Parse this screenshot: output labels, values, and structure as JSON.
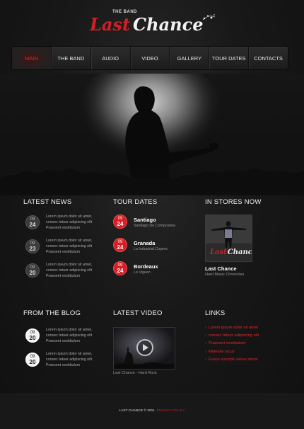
{
  "logo": {
    "small": "THE BAND",
    "word1": "Last",
    "word2": "Chance"
  },
  "nav": [
    "MAIN",
    "THE BAND",
    "AUDIO",
    "VIDEO",
    "GALLERY",
    "TOUR DATES",
    "CONTACTS"
  ],
  "nav_active_index": 0,
  "latest_news": {
    "title": "LATEST NEWS",
    "items": [
      {
        "month": "09",
        "day": "24",
        "l1": "Lorem ipsum dolor sit amet,",
        "l2": "consec tetuer adipiscing elit",
        "l3": "Praesent vestibulum"
      },
      {
        "month": "09",
        "day": "23",
        "l1": "Lorem ipsum dolor sit amet,",
        "l2": "consec tetuer adipiscing elit",
        "l3": "Praesent vestibulum"
      },
      {
        "month": "09",
        "day": "20",
        "l1": "Lorem ipsum dolor sit amet,",
        "l2": "consec tetuer adipiscing elit",
        "l3": "Praesent vestibulum"
      }
    ]
  },
  "tour_dates": {
    "title": "TOUR DATES",
    "items": [
      {
        "month": "09",
        "day": "24",
        "city": "Santiago",
        "venue": "Santiago De Compostela"
      },
      {
        "month": "09",
        "day": "24",
        "city": "Granada",
        "venue": "La Industrial Copera"
      },
      {
        "month": "09",
        "day": "24",
        "city": "Bordeaux",
        "venue": "Le Vigean"
      }
    ]
  },
  "in_stores": {
    "title": "IN STORES NOW",
    "album_title": "Last Chance",
    "album_label": "Hard Music Chronicles",
    "cover_word1": "Last",
    "cover_word2": "Chance"
  },
  "blog": {
    "title": "FROM THE BLOG",
    "items": [
      {
        "month": "09",
        "day": "20",
        "l1": "Lorem ipsum dolor sit amet,",
        "l2": "consec tetuer adipiscing elit",
        "l3": "Praesent vestibulum"
      },
      {
        "month": "09",
        "day": "20",
        "l1": "Lorem ipsum dolor sit amet,",
        "l2": "consec tetuer adipiscing elit",
        "l3": "Praesent vestibulum"
      }
    ]
  },
  "latest_video": {
    "title": "LATEST VIDEO",
    "caption": "Last Chance - Hard Rock"
  },
  "links": {
    "title": "LINKS",
    "items": [
      "Lorem ipsum dolor sit amet",
      "consec tetuer adipiscing elit",
      "Praesent vestibulum",
      "Molestie lacus",
      "Fusce suscipit varius mium"
    ]
  },
  "footer": {
    "copyright": "LAST CHANCE © 2011",
    "privacy": "PRIVACY POLICY"
  },
  "colors": {
    "accent": "#d21f26",
    "background": "#141414"
  }
}
